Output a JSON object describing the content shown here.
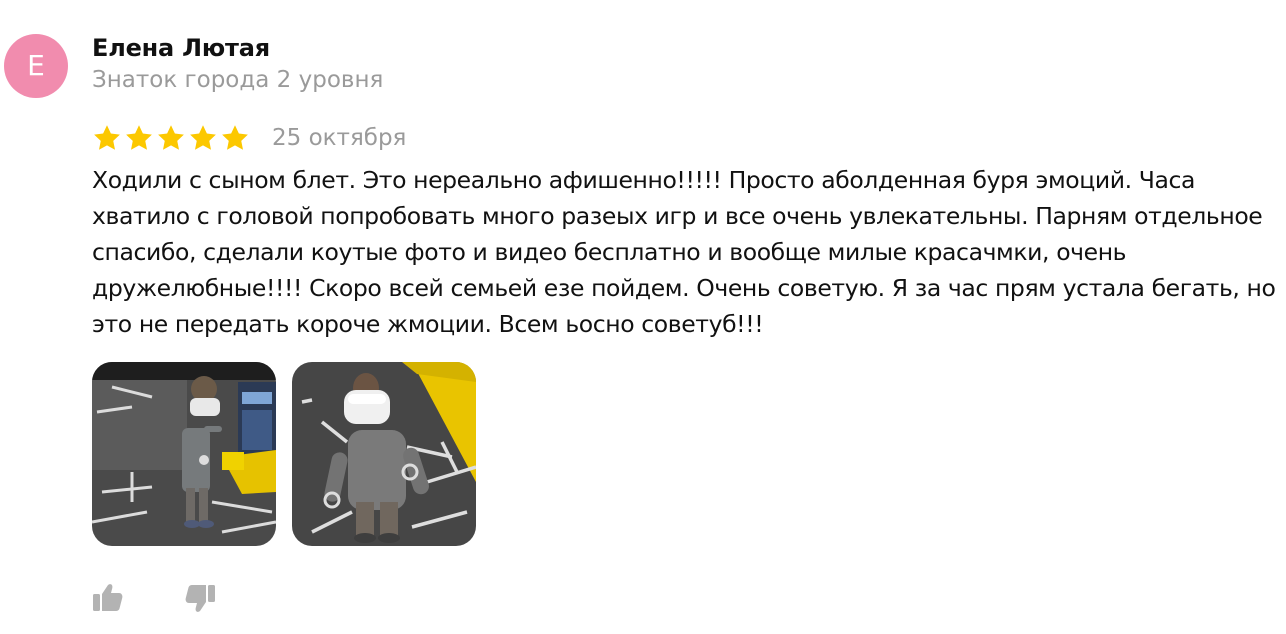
{
  "review": {
    "author": {
      "avatar_letter": "Е",
      "avatar_color": "#f18cae",
      "name": "Елена Лютая",
      "level": "Знаток города 2 уровня"
    },
    "rating": 5,
    "rating_max": 5,
    "star_color": "#fcc800",
    "date": "25 октября",
    "text": "Ходили с сыном блет. Это нереально афишенно!!!!! Просто аболденная буря эмоций. Часа хватило с головой попробовать много разеых игр и все очень увлекательны. Парням отдельное спасибо, сделали коутые фото и видео бесплатно и вообще милые красачмки, очень дружелюбные!!!! Скоро всей семьей езе пойдем. Очень советую. Я за час прям устала бегать, но это не передать короче жмоции. Всем ьосно советуб!!!",
    "photos": [
      {
        "name": "review-photo-1",
        "accent_color": "#f5c800"
      },
      {
        "name": "review-photo-2",
        "accent_color": "#f5c800"
      }
    ],
    "reactions": {
      "like_icon": "thumbs-up-icon",
      "dislike_icon": "thumbs-down-icon",
      "icon_color": "#b3b3b3"
    }
  }
}
